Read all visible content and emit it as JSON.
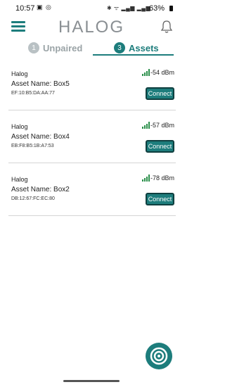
{
  "status_bar": {
    "time": "10:57",
    "battery": "63%"
  },
  "header": {
    "logo": "HALOG"
  },
  "tabs": [
    {
      "number": "1",
      "label": "Unpaired"
    },
    {
      "number": "3",
      "label": "Assets"
    }
  ],
  "assets": [
    {
      "brand": "Halog",
      "name": "Asset Name: Box5",
      "mac": "EF:10:B5:DA:AA:77",
      "rssi": "-54 dBm",
      "connect_label": "Connect"
    },
    {
      "brand": "Halog",
      "name": "Asset Name: Box4",
      "mac": "EB:F8:B5:1B:A7:53",
      "rssi": "-57 dBm",
      "connect_label": "Connect"
    },
    {
      "brand": "Halog",
      "name": "Asset Name: Box2",
      "mac": "DB:12:67:FC:EC:80",
      "rssi": "-78 dBm",
      "connect_label": "Connect"
    }
  ],
  "colors": {
    "accent": "#1d7d7c",
    "signal": "#2a8f4a"
  }
}
